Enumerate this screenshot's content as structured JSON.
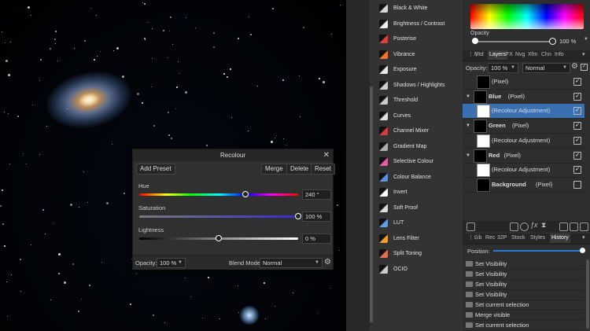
{
  "dialog": {
    "title": "Recolour",
    "close": "✕",
    "add_preset": "Add Preset",
    "merge": "Merge",
    "delete": "Delete",
    "reset": "Reset",
    "hue": {
      "label": "Hue",
      "value": "240 °",
      "level": 0.67
    },
    "saturation": {
      "label": "Saturation",
      "value": "100 %",
      "level": 1.0
    },
    "lightness": {
      "label": "Lightness",
      "value": "0 %",
      "level": 0.5
    },
    "opacity_label": "Opacity:",
    "opacity_value": "100 %",
    "blend_label": "Blend Mode:",
    "blend_value": "Normal"
  },
  "adjustments": [
    {
      "label": "Black & White",
      "color": "#d8d8d8"
    },
    {
      "label": "Brightness / Contrast",
      "color": "#eeeeee"
    },
    {
      "label": "Posterise",
      "color": "#e04040"
    },
    {
      "label": "Vibrance",
      "color": "#f07030"
    },
    {
      "label": "Exposure",
      "color": "#e8e8e8"
    },
    {
      "label": "Shadows / Highlights",
      "color": "#cfcfcf"
    },
    {
      "label": "Threshold",
      "color": "#cccccc"
    },
    {
      "label": "Curves",
      "color": "#e0e0e0"
    },
    {
      "label": "Channel Mixer",
      "color": "#d04040"
    },
    {
      "label": "Gradient Map",
      "color": "#b0b0b0"
    },
    {
      "label": "Selective Colour",
      "color": "#e060a0"
    },
    {
      "label": "Colour Balance",
      "color": "#6090e0"
    },
    {
      "label": "Invert",
      "color": "#ffffff"
    },
    {
      "label": "Soft Proof",
      "color": "#dddddd"
    },
    {
      "label": "LUT",
      "color": "#60a0e0"
    },
    {
      "label": "Lens Filter",
      "color": "#f0a030"
    },
    {
      "label": "Split Toning",
      "color": "#e07050"
    },
    {
      "label": "OCIO",
      "color": "#cccccc"
    }
  ],
  "color_panel": {
    "opacity_label": "Opacity",
    "opacity_value": "100 %"
  },
  "layers_tabs": [
    "Mtd",
    "Layers",
    "FX",
    "Nvg",
    "Xfm",
    "Chn",
    "Info"
  ],
  "layers_active_tab": "Layers",
  "layers_opacity_label": "Opacity:",
  "layers_opacity_value": "100 %",
  "layers_blend_value": "Normal",
  "layers": [
    {
      "name": "(Pixel)",
      "indent": 1,
      "thumb": "black",
      "caret": "",
      "bold": false,
      "selected": false,
      "checked": true
    },
    {
      "name": "Blue",
      "suffix": "(Pixel)",
      "indent": 0,
      "thumb": "black",
      "caret": "▼",
      "bold": true,
      "selected": false,
      "checked": true
    },
    {
      "name": "(Recolour Adjustment)",
      "indent": 1,
      "thumb": "white",
      "caret": "",
      "bold": false,
      "selected": true,
      "checked": true
    },
    {
      "name": "Green",
      "suffix": "(Pixel)",
      "indent": 0,
      "thumb": "black",
      "caret": "▼",
      "bold": true,
      "selected": false,
      "checked": true
    },
    {
      "name": "(Recolour Adjustment)",
      "indent": 1,
      "thumb": "white",
      "caret": "",
      "bold": false,
      "selected": false,
      "checked": true
    },
    {
      "name": "Red",
      "suffix": "(Pixel)",
      "indent": 0,
      "thumb": "black",
      "caret": "▼",
      "bold": true,
      "selected": false,
      "checked": true
    },
    {
      "name": "(Recolour Adjustment)",
      "indent": 1,
      "thumb": "white",
      "caret": "",
      "bold": false,
      "selected": false,
      "checked": true
    },
    {
      "name": "Background",
      "suffix": "(Pixel)",
      "indent": 1,
      "thumb": "black",
      "caret": "",
      "bold": true,
      "selected": false,
      "checked": false
    }
  ],
  "history_tabs": [
    "Lib",
    "Rec",
    "32P",
    "Stock",
    "Styles",
    "History"
  ],
  "history_active_tab": "History",
  "history_position_label": "Position:",
  "history_position_level": 1.0,
  "history": [
    "Set Visibility",
    "Set Visibility",
    "Set Visibility",
    "Set Visibility",
    "Set current selection",
    "Merge visible",
    "Set current selection"
  ]
}
